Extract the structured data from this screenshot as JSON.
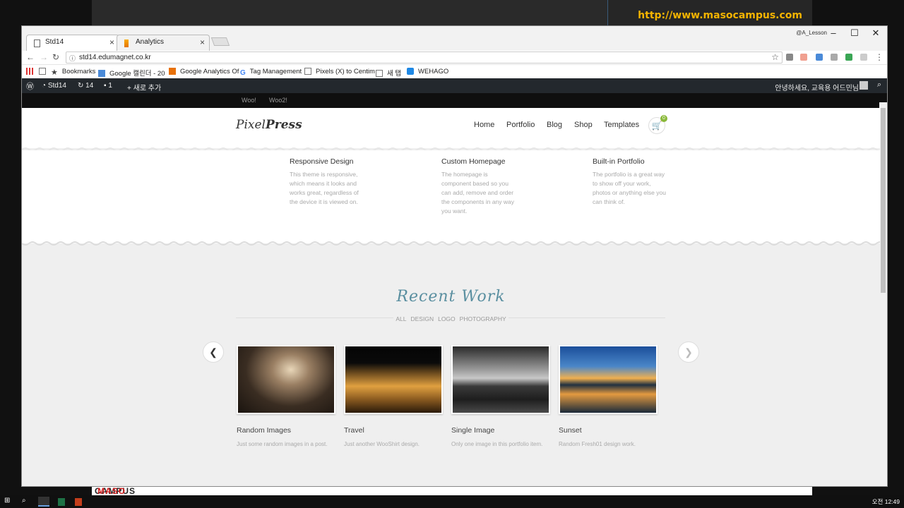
{
  "desktop": {
    "banner_url": "http://www.masocampus.com",
    "bottom_brand_a": "MASO",
    "bottom_brand_b": " CAMPUS"
  },
  "browser": {
    "tabs": [
      {
        "label": "Std14",
        "icon": "page-icon"
      },
      {
        "label": "Analytics",
        "icon": "analytics-icon"
      }
    ],
    "user_label": "@A_Lesson",
    "address": "std14.edumagnet.co.kr",
    "bookmarks": [
      {
        "label": "",
        "icon": "apps-icon"
      },
      {
        "label": "",
        "icon": "page-icon"
      },
      {
        "label": "Bookmarks",
        "icon": "star-icon"
      },
      {
        "label": "Google 캘린더 - 20",
        "icon": "calendar-icon"
      },
      {
        "label": "Google Analytics Of",
        "icon": "analytics-icon"
      },
      {
        "label": "Tag Management",
        "icon": "google-icon"
      },
      {
        "label": "Pixels (X) to Centim",
        "icon": "page-icon"
      },
      {
        "label": "새 탭",
        "icon": "page-icon"
      },
      {
        "label": "WEHAGO",
        "icon": "wehago-icon"
      }
    ]
  },
  "wp_admin": {
    "site": "Std14",
    "updates": "14",
    "comments": "1",
    "new": "새로 추가",
    "greeting": "안녕하세요, 교육용 어드민님"
  },
  "site": {
    "top_menu": [
      "Woo!",
      "Woo2!"
    ],
    "logo_a": "Pixel",
    "logo_b": "Press",
    "nav": [
      "Home",
      "Portfolio",
      "Blog",
      "Shop",
      "Templates"
    ],
    "cart_count": "0",
    "features": [
      {
        "title": "Responsive Design",
        "text": "This theme is responsive, which means it looks and works great, regardless of the device it is viewed on."
      },
      {
        "title": "Custom Homepage",
        "text": "The homepage is component based so you can add, remove and order the components in any way you want."
      },
      {
        "title": "Built-in Portfolio",
        "text": "The portfolio is a great way to show off your work, photos or anything else you can think of."
      }
    ],
    "recent_title": "Recent Work",
    "filters": [
      "ALL",
      "DESIGN",
      "LOGO",
      "PHOTOGRAPHY"
    ],
    "works": [
      {
        "title": "Random Images",
        "desc": "Just some random images in a post."
      },
      {
        "title": "Travel",
        "desc": "Just another WooShirt design."
      },
      {
        "title": "Single Image",
        "desc": "Only one image in this portfolio item."
      },
      {
        "title": "Sunset",
        "desc": "Random Fresh01 design work."
      }
    ]
  },
  "taskbar": {
    "clock": "오전 12:49"
  }
}
